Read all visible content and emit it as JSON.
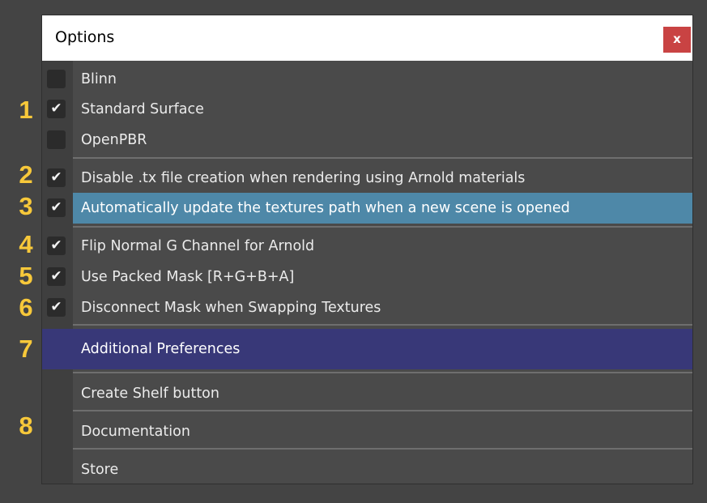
{
  "window": {
    "title": "Options",
    "close_label": "x"
  },
  "callouts": [
    "1",
    "2",
    "3",
    "4",
    "5",
    "6",
    "7",
    "8"
  ],
  "shader_options": [
    {
      "label": "Blinn",
      "checked": false
    },
    {
      "label": "Standard Surface",
      "checked": true
    },
    {
      "label": "OpenPBR",
      "checked": false
    }
  ],
  "render_options": [
    {
      "label": "Disable .tx file creation when rendering using Arnold materials",
      "checked": true
    },
    {
      "label": "Automatically update the textures path when a new scene is opened",
      "checked": true
    }
  ],
  "texture_options": [
    {
      "label": "Flip Normal G Channel for Arnold",
      "checked": true
    },
    {
      "label": "Use Packed Mask [R+G+B+A]",
      "checked": true
    },
    {
      "label": "Disconnect Mask when Swapping Textures",
      "checked": true
    }
  ],
  "additional_preferences": "Additional Preferences",
  "links": [
    {
      "label": "Create Shelf button"
    },
    {
      "label": "Documentation"
    },
    {
      "label": "Store"
    }
  ],
  "colors": {
    "accent_highlight": "#4e88a8",
    "preferences_bar": "#383878",
    "close_button": "#c94343",
    "callout": "#f7c83a"
  },
  "icons": {
    "check": "check-icon",
    "close": "close-icon"
  }
}
